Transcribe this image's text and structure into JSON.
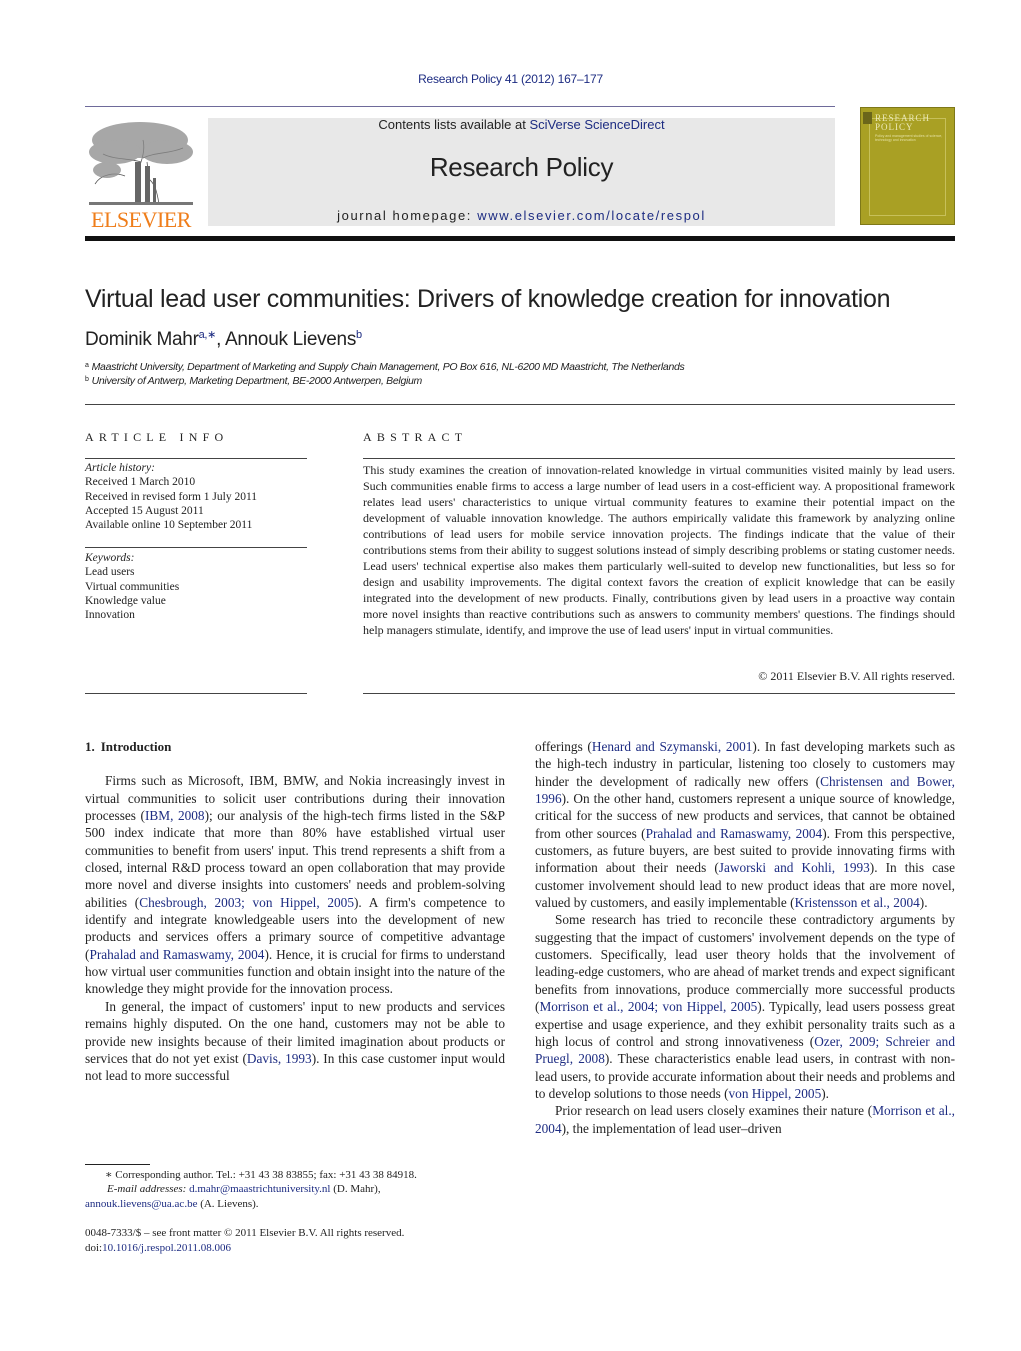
{
  "header": {
    "citation": "Research Policy 41 (2012) 167–177",
    "contents_prefix": "Contents lists available at ",
    "contents_link": "SciVerse ScienceDirect",
    "journal_name": "Research Policy",
    "homepage_prefix": "journal homepage: ",
    "homepage_link": "www.elsevier.com/locate/respol",
    "publisher_logo_text": "ELSEVIER",
    "cover": {
      "title_line1": "RESEARCH",
      "title_line2": "POLICY",
      "subtitle": "Policy and management studies of science, technology and innovation"
    },
    "colors": {
      "link": "#1d2c82",
      "elsevier_orange": "#ef7d1a",
      "cover_olive": "#a9a024",
      "masthead_gray": "#e8e8e8"
    }
  },
  "article": {
    "title": "Virtual lead user communities: Drivers of knowledge creation for innovation",
    "authors": [
      {
        "name": "Dominik Mahr",
        "marks": "a,∗"
      },
      {
        "name": "Annouk Lievens",
        "marks": "b"
      }
    ],
    "author_separator": ", ",
    "affiliations": [
      {
        "mark": "a",
        "text": "Maastricht University, Department of Marketing and Supply Chain Management, PO Box 616, NL-6200 MD Maastricht, The Netherlands"
      },
      {
        "mark": "b",
        "text": "University of Antwerp, Marketing Department, BE-2000 Antwerpen, Belgium"
      }
    ]
  },
  "article_info": {
    "heading": "ARTICLE INFO",
    "history_label": "Article history:",
    "history": [
      "Received 1 March 2010",
      "Received in revised form 1 July 2011",
      "Accepted 15 August 2011",
      "Available online 10 September 2011"
    ],
    "keywords_label": "Keywords:",
    "keywords": [
      "Lead users",
      "Virtual communities",
      "Knowledge value",
      "Innovation"
    ]
  },
  "abstract": {
    "heading": "ABSTRACT",
    "text": "This study examines the creation of innovation-related knowledge in virtual communities visited mainly by lead users. Such communities enable firms to access a large number of lead users in a cost-efficient way. A propositional framework relates lead users' characteristics to unique virtual community features to examine their potential impact on the development of valuable innovation knowledge. The authors empirically validate this framework by analyzing online contributions of lead users for mobile service innovation projects. The findings indicate that the value of their contributions stems from their ability to suggest solutions instead of simply describing problems or stating customer needs. Lead users' technical expertise also makes them particularly well-suited to develop new functionalities, but less so for design and usability improvements. The digital context favors the creation of explicit knowledge that can be easily integrated into the development of new products. Finally, contributions given by lead users in a proactive way contain more novel insights than reactive contributions such as answers to community members' questions. The findings should help managers stimulate, identify, and improve the use of lead users' input in virtual communities.",
    "copyright": "© 2011 Elsevier B.V. All rights reserved."
  },
  "body": {
    "section": {
      "number": "1.",
      "title": "Introduction"
    },
    "left": {
      "p1": {
        "t1": "Firms such as Microsoft, IBM, BMW, and Nokia increasingly invest in virtual communities to solicit user contributions during their innovation processes (",
        "c1": "IBM, 2008",
        "t2": "); our analysis of the high-tech firms listed in the S&P 500 index indicate that more than 80% have established virtual user communities to benefit from users' input. This trend represents a shift from a closed, internal R&D process toward an open collaboration that may provide more novel and diverse insights into customers' needs and problem-solving abilities (",
        "c2": "Chesbrough, 2003; von Hippel, 2005",
        "t3": "). A firm's competence to identify and integrate knowledgeable users into the development of new products and services offers a primary source of competitive advantage (",
        "c3": "Prahalad and Ramaswamy, 2004",
        "t4": "). Hence, it is crucial for firms to understand how virtual user communities function and obtain insight into the nature of the knowledge they might provide for the innovation process."
      },
      "p2": {
        "t1": "In general, the impact of customers' input to new products and services remains highly disputed. On the one hand, customers may not be able to provide new insights because of their limited imagination about products or services that do not yet exist (",
        "c1": "Davis, 1993",
        "t2": "). In this case customer input would not lead to more successful"
      }
    },
    "right": {
      "p1": {
        "t1": "offerings (",
        "c1": "Henard and Szymanski, 2001",
        "t2": "). In fast developing markets such as the high-tech industry in particular, listening too closely to customers may hinder the development of radically new offers (",
        "c2": "Christensen and Bower, 1996",
        "t3": "). On the other hand, customers represent a unique source of knowledge, critical for the success of new products and services, that cannot be obtained from other sources (",
        "c3": "Prahalad and Ramaswamy, 2004",
        "t4": "). From this perspective, customers, as future buyers, are best suited to provide innovating firms with information about their needs (",
        "c4": "Jaworski and Kohli, 1993",
        "t5": "). In this case customer involvement should lead to new product ideas that are more novel, valued by customers, and easily implementable (",
        "c5": "Kristensson et al., 2004",
        "t6": ")."
      },
      "p2": {
        "t1": "Some research has tried to reconcile these contradictory arguments by suggesting that the impact of customers' involvement depends on the type of customers. Specifically, lead user theory holds that the involvement of leading-edge customers, who are ahead of market trends and expect significant benefits from innovations, produce commercially more successful products (",
        "c1": "Morrison et al., 2004; von Hippel, 2005",
        "t2": "). Typically, lead users possess great expertise and usage experience, and they exhibit personality traits such as a high locus of control and strong innovativeness (",
        "c2": "Ozer, 2009; Schreier and Pruegl, 2008",
        "t3": "). These characteristics enable lead users, in contrast with non-lead users, to provide accurate information about their needs and problems and to develop solutions to those needs (",
        "c3": "von Hippel, 2005",
        "t4": ")."
      },
      "p3": {
        "t1": "Prior research on lead users closely examines their nature (",
        "c1": "Morrison et al., 2004",
        "t2": "), the implementation of lead user–driven"
      }
    }
  },
  "footnotes": {
    "corresponding": "∗ Corresponding author. Tel.: +31 43 38 83855; fax: +31 43 38 84918.",
    "email_label": "E-mail addresses:",
    "email1": "d.mahr@maastrichtuniversity.nl",
    "email1_owner": " (D. Mahr),",
    "email2": "annouk.lievens@ua.ac.be",
    "email2_owner": " (A. Lievens).",
    "front_matter": "0048-7333/$ – see front matter © 2011 Elsevier B.V. All rights reserved.",
    "doi_prefix": "doi:",
    "doi": "10.1016/j.respol.2011.08.006"
  }
}
